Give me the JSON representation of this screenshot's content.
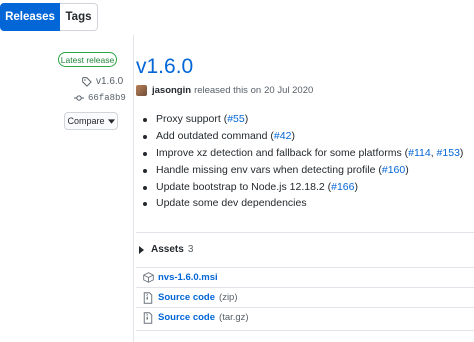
{
  "tabs": [
    {
      "label": "Releases",
      "active": true
    },
    {
      "label": "Tags",
      "active": false
    }
  ],
  "sidebar": {
    "badge": "Latest release",
    "tag": "v1.6.0",
    "commit": "66fa8b9",
    "compare_label": "Compare"
  },
  "release": {
    "title": "v1.6.0",
    "author": "jasongin",
    "released_text": "released this on",
    "date": "20 Jul 2020",
    "notes": [
      {
        "text": "Proxy support (",
        "link": "#55",
        "tail": ")"
      },
      {
        "text": "Add outdated command (",
        "link": "#42",
        "tail": ")"
      },
      {
        "text": "Improve xz detection and fallback for some platforms (",
        "link": "#114",
        "sep": ", ",
        "link2": "#153",
        "tail": ")"
      },
      {
        "text": "Handle missing env vars when detecting profile (",
        "link": "#160",
        "tail": ")"
      },
      {
        "text": "Update bootstrap to Node.js 12.18.2 (",
        "link": "#166",
        "tail": ")"
      },
      {
        "text": "Update some dev dependencies"
      }
    ]
  },
  "assets": {
    "label": "Assets",
    "count": "3",
    "items": [
      {
        "name": "nvs-1.6.0.msi",
        "format": "",
        "icon": "package-icon"
      },
      {
        "name": "Source code",
        "format": "(zip)",
        "icon": "file-zip-icon"
      },
      {
        "name": "Source code",
        "format": "(tar.gz)",
        "icon": "file-zip-icon"
      }
    ]
  },
  "colors": {
    "accent": "#0366d6",
    "success": "#28a745",
    "text": "#24292e",
    "muted": "#586069",
    "border": "#e1e4e8"
  }
}
